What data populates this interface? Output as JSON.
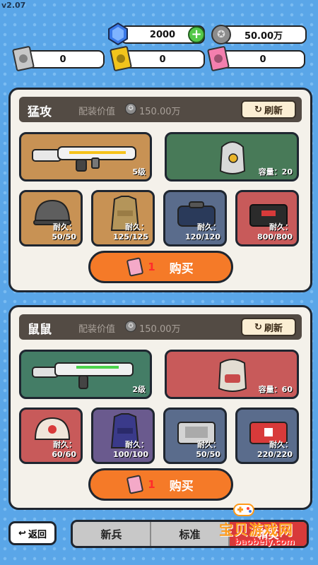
{
  "app": {
    "version": "v2.07"
  },
  "currency": {
    "gems": "2000",
    "coins": "50.00万",
    "ticket_gray": "0",
    "ticket_yellow": "0",
    "ticket_pink": "0",
    "colors": {
      "gem": "#3a78e8",
      "ticket_gray": "#c7c7c7",
      "ticket_yellow": "#f2c41c",
      "ticket_pink": "#f37fae"
    }
  },
  "panels": [
    {
      "name": "猛攻",
      "value_label": "配装价值",
      "value": "150.00万",
      "refresh_label": "刷新",
      "weapon": {
        "level": "5级",
        "icon": "rifle-icon"
      },
      "backpack": {
        "capacity_label": "容量：20",
        "icon": "backpack-icon"
      },
      "items": [
        {
          "icon": "helmet-icon",
          "dur_label": "耐久：",
          "dur": "50/50"
        },
        {
          "icon": "armor-vest-icon",
          "dur_label": "耐久：",
          "dur": "125/125"
        },
        {
          "icon": "bag-icon",
          "dur_label": "耐久：",
          "dur": "120/120"
        },
        {
          "icon": "case-icon",
          "dur_label": "耐久：",
          "dur": "800/800"
        }
      ],
      "buy": {
        "count": "1",
        "label": "购买"
      }
    },
    {
      "name": "鼠鼠",
      "value_label": "配装价值",
      "value": "150.00万",
      "refresh_label": "刷新",
      "weapon": {
        "level": "2级",
        "icon": "rifle-icon"
      },
      "backpack": {
        "capacity_label": "容量：60",
        "icon": "backpack-icon"
      },
      "items": [
        {
          "icon": "helmet-icon",
          "dur_label": "耐久：",
          "dur": "60/60"
        },
        {
          "icon": "armor-vest-icon",
          "dur_label": "耐久：",
          "dur": "100/100"
        },
        {
          "icon": "case-icon",
          "dur_label": "耐久：",
          "dur": "50/50"
        },
        {
          "icon": "case-icon",
          "dur_label": "耐久：",
          "dur": "220/220"
        }
      ],
      "buy": {
        "count": "1",
        "label": "购买"
      }
    }
  ],
  "bottom": {
    "back_label": "返回",
    "tabs": [
      "新兵",
      "标准",
      "精英"
    ]
  },
  "watermark": {
    "main": "宝贝游戏网",
    "sub": "baobeiy.com"
  }
}
